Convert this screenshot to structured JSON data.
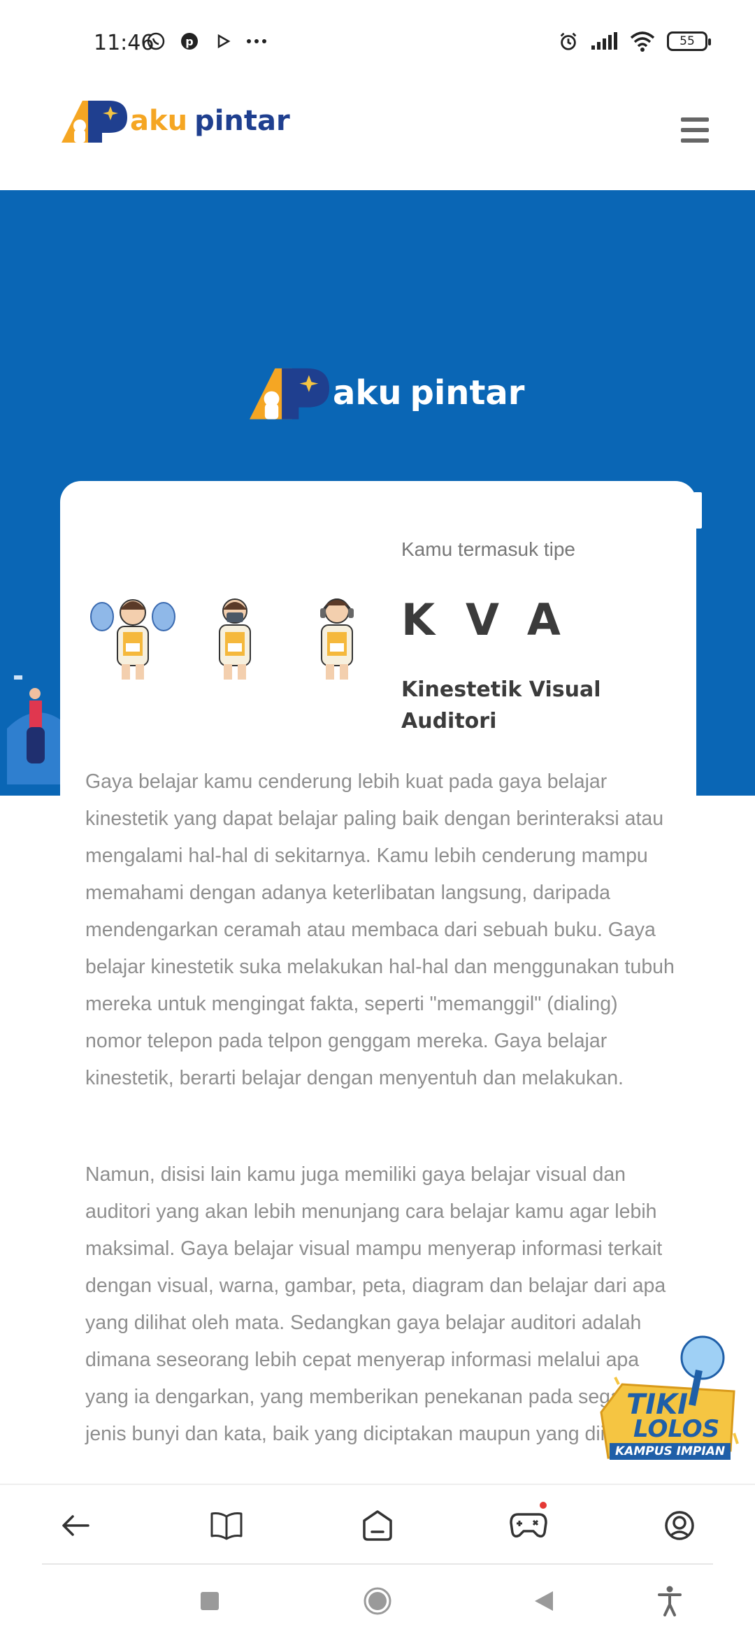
{
  "status_bar": {
    "time": "11:46",
    "battery": "55",
    "icons_left": [
      "whatsapp-icon",
      "pinterest-icon",
      "play-icon",
      "more-icon"
    ],
    "icons_right": [
      "alarm-icon",
      "signal-icon",
      "wifi-icon",
      "battery-icon"
    ]
  },
  "brand": {
    "name_part1": "aku",
    "name_part2": "pintar",
    "colors": {
      "orange": "#f5a623",
      "navy": "#1f3f8f",
      "blue_bg": "#0a66b5"
    }
  },
  "result": {
    "intro": "Kamu termasuk tipe",
    "code": "KVA",
    "type_name": "Kinestetik Visual Auditori",
    "paragraph_1": "Gaya belajar kamu cenderung lebih kuat pada gaya belajar kinestetik yang dapat belajar paling baik dengan berinteraksi atau mengalami hal-hal di sekitarnya. Kamu lebih cenderung mampu memahami dengan adanya keterlibatan langsung, daripada mendengarkan ceramah atau membaca dari sebuah buku. Gaya belajar kinestetik suka melakukan hal-hal dan menggunakan tubuh mereka untuk mengingat fakta, seperti \"memanggil\" (dialing) nomor telepon pada telpon genggam mereka. Gaya belajar kinestetik, berarti belajar dengan menyentuh dan melakukan.",
    "paragraph_2": "Namun, disisi lain kamu juga memiliki gaya belajar visual dan auditori yang akan lebih menunjang cara belajar kamu agar lebih maksimal. Gaya belajar visual mampu menyerap informasi terkait dengan visual, warna, gambar, peta, diagram dan belajar dari apa yang dilihat oleh mata. Sedangkan gaya belajar auditori adalah dimana seseorang lebih cepat menyerap informasi melalui apa yang ia dengarkan, yang memberikan penekanan pada segala jenis bunyi dan kata, baik yang diciptakan maupun yang diingat."
  },
  "promo": {
    "line1": "TIKI",
    "line2": "LOLOS",
    "line3": "KAMPUS IMPIAN"
  },
  "bottom_nav": [
    "back-icon",
    "book-icon",
    "home-icon",
    "game-icon",
    "profile-icon"
  ],
  "system_nav": [
    "recents-icon",
    "home-circle-icon",
    "back-triangle-icon",
    "accessibility-icon"
  ]
}
